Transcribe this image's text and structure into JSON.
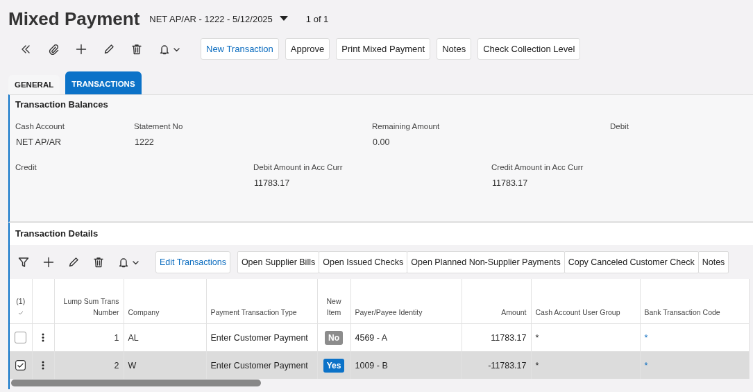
{
  "title": "Mixed Payment",
  "record": "NET AP/AR - 1222 - 5/12/2025",
  "pager": "1 of 1",
  "toolbar": [
    {
      "label": "New Transaction",
      "kind": "primary"
    },
    {
      "label": "Approve",
      "kind": "plain"
    },
    {
      "label": "Print Mixed Payment",
      "kind": "plain"
    },
    {
      "label": "Notes",
      "kind": "plain"
    },
    {
      "label": "Check Collection Level",
      "kind": "plain"
    }
  ],
  "tabs": [
    {
      "label": "GENERAL",
      "selected": false
    },
    {
      "label": "TRANSACTIONS",
      "selected": true
    }
  ],
  "balances": {
    "title": "Transaction Balances",
    "rows": [
      [
        {
          "label": "Cash Account",
          "value": "NET AP/AR"
        },
        {
          "label": "Statement No",
          "value": "1222"
        },
        {
          "label": "Remaining Amount",
          "value": "0.00"
        },
        {
          "label": "Debit"
        }
      ],
      [
        {
          "label": "Credit"
        },
        {
          "label": "Debit Amount in Acc Curr",
          "value": "11783.17"
        },
        {
          "label": "Credit Amount in Acc Curr",
          "value": "11783.17"
        }
      ]
    ]
  },
  "details": {
    "title": "Transaction Details",
    "toolbar": [
      {
        "label": "Edit Transactions",
        "kind": "primary"
      },
      {
        "label": "Open Supplier Bills",
        "kind": "plain"
      },
      {
        "label": "Open Issued Checks",
        "kind": "plain"
      },
      {
        "label": "Open Planned Non-Supplier Payments",
        "kind": "plain"
      },
      {
        "label": "Copy Canceled Customer Check",
        "kind": "plain"
      },
      {
        "label": "Notes",
        "kind": "plain"
      }
    ],
    "selected_count": "(1)",
    "columns": [
      "Lump Sum Trans Number",
      "Company",
      "Payment Transaction Type",
      "New Item",
      "Payer/Payee Identity",
      "Amount",
      "Cash Account User Group",
      "Bank Transaction Code"
    ],
    "rows": [
      {
        "selected": false,
        "number": "1",
        "company": "AL",
        "type": "Enter Customer Payment",
        "new_item": {
          "label": "No",
          "color": "#8c8c8c"
        },
        "payer": "4569 - A",
        "amount": "11783.17",
        "user_group": "*",
        "bank_code": "*"
      },
      {
        "selected": true,
        "number": "2",
        "company": "W",
        "type": "Enter Customer Payment",
        "new_item": {
          "label": "Yes",
          "color": "#0b72c8"
        },
        "payer": "1009 - B",
        "amount": "-11783.17",
        "user_group": "*",
        "bank_code": "*"
      }
    ]
  }
}
